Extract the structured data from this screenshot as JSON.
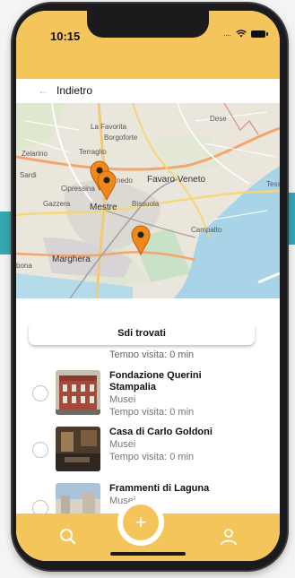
{
  "status": {
    "time": "10:15",
    "carrier_dots": "...."
  },
  "nav": {
    "back_label": "Indietro"
  },
  "map": {
    "places": [
      "La Favorita",
      "Borgoforte",
      "Zelarino",
      "Terraglio",
      "Dese",
      "Sardi",
      "Cipressina",
      "nedo",
      "Favaro Veneto",
      "Gazzera",
      "Mestre",
      "Bissuola",
      "Campalto",
      "Tess",
      "Marghera",
      "bona"
    ]
  },
  "list": {
    "button_label": "Sdi trovati",
    "partial_visit_text": "Tempo visita: 0 min",
    "items": [
      {
        "title_line1": "Fondazione Querini",
        "title_line2": "Stampalia",
        "category": "Musei",
        "visit": "Tempo visita: 0 min"
      },
      {
        "title_line1": "Casa di Carlo Goldoni",
        "title_line2": "",
        "category": "Musei",
        "visit": "Tempo visita: 0 min"
      },
      {
        "title_line1": "Frammenti di Laguna",
        "title_line2": "",
        "category": "Musei",
        "visit": ""
      }
    ]
  },
  "tabbar": {
    "add_glyph": "+",
    "search_icon": "search-icon",
    "profile_icon": "user-icon"
  },
  "colors": {
    "accent": "#f4c55a",
    "marker": "#f0891a"
  }
}
